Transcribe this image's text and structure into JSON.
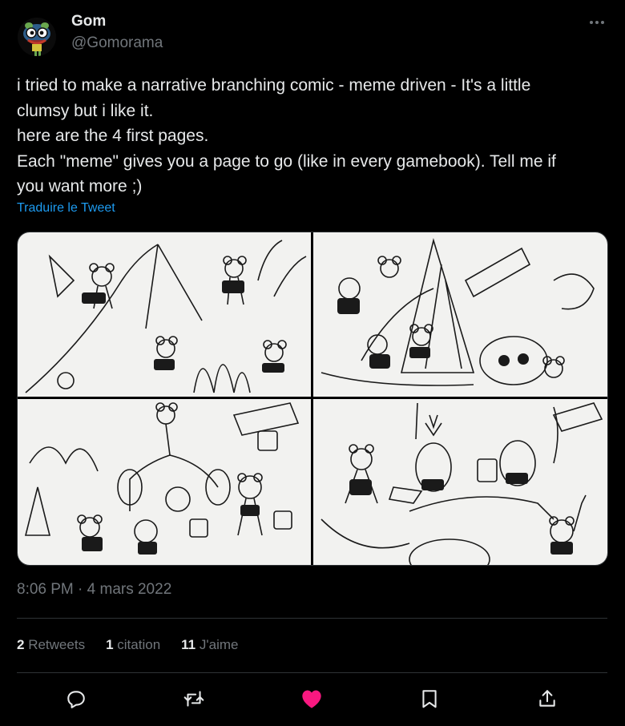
{
  "author": {
    "name": "Gom",
    "handle": "@Gomorama"
  },
  "tweet": {
    "lines": [
      "i tried to make a narrative branching comic - meme driven - It's a little",
      "clumsy but i like it.",
      "here are the 4 first pages.",
      "Each \"meme\" gives you a page to go (like in every gamebook). Tell me if",
      "you want more ;)"
    ],
    "translate_label": "Traduire le Tweet",
    "timestamp": "8:06 PM · 4 mars 2022"
  },
  "stats": {
    "retweets_count": "2",
    "retweets_label": "Retweets",
    "quotes_count": "1",
    "quotes_label": "citation",
    "likes_count": "11",
    "likes_label": "J'aime"
  },
  "icons": {
    "more": "more-horizontal-icon",
    "reply": "reply-icon",
    "retweet": "retweet-icon",
    "like": "heart-icon",
    "bookmark": "bookmark-icon",
    "share": "share-icon"
  },
  "colors": {
    "background": "#000000",
    "text": "#e7e9ea",
    "secondary": "#71767b",
    "link": "#1d9bf0",
    "like": "#f91880",
    "border": "#2f3336"
  }
}
